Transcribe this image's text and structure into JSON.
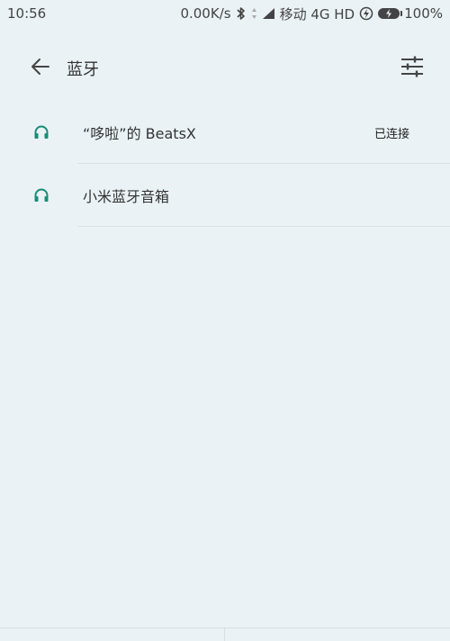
{
  "status_bar": {
    "time": "10:56",
    "speed": "0.00K/s",
    "carrier": "移动 4G HD",
    "battery": "100%"
  },
  "header": {
    "title": "蓝牙"
  },
  "devices": [
    {
      "name": "“哆啦”的 BeatsX",
      "status": "已连接",
      "icon": "headphones-icon"
    },
    {
      "name": "小米蓝牙音箱",
      "status": "",
      "icon": "headphones-icon"
    }
  ],
  "colors": {
    "background": "#eaf2f6",
    "accent": "#1a8c76"
  }
}
